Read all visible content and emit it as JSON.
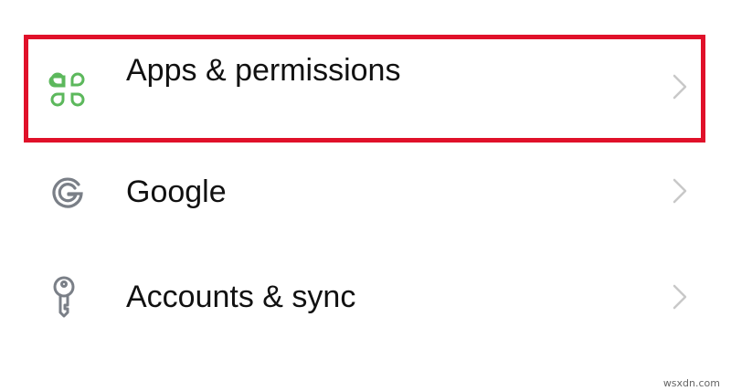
{
  "settings": {
    "items": [
      {
        "label": "Apps & permissions",
        "icon": "apps-icon",
        "icon_color": "#5cb85c"
      },
      {
        "label": "Google",
        "icon": "google-icon",
        "icon_color": "#7a7f87"
      },
      {
        "label": "Accounts & sync",
        "icon": "key-icon",
        "icon_color": "#7a7f87"
      }
    ]
  },
  "highlight": {
    "color": "#e0112a",
    "target": "Apps & permissions"
  },
  "watermark": {
    "text": "wsxdn.com"
  },
  "colors": {
    "text": "#111111",
    "chevron": "#c8c8c8",
    "background": "#ffffff"
  }
}
